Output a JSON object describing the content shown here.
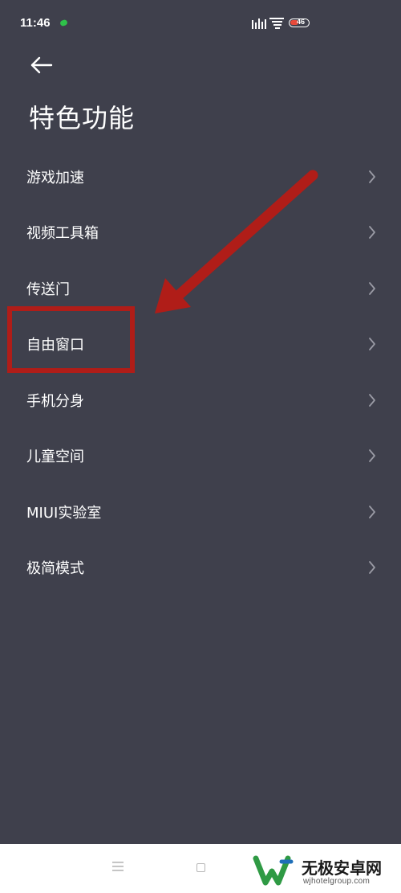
{
  "status_bar": {
    "time": "11:46",
    "battery_level": "46",
    "icons": [
      "wechat-icon",
      "signal-icon",
      "wifi-icon",
      "battery-icon"
    ]
  },
  "header": {
    "back_icon": "back-arrow-icon",
    "title": "特色功能"
  },
  "menu": {
    "items": [
      {
        "label": "游戏加速"
      },
      {
        "label": "视频工具箱"
      },
      {
        "label": "传送门"
      },
      {
        "label": "自由窗口"
      },
      {
        "label": "手机分身"
      },
      {
        "label": "儿童空间"
      },
      {
        "label": "MIUI实验室"
      },
      {
        "label": "极简模式"
      }
    ],
    "chevron_icon": "chevron-right-icon"
  },
  "annotation": {
    "highlighted_item": "自由窗口",
    "color": "#b01d18"
  },
  "nav_bar": {
    "icons": [
      "menu-icon",
      "home-icon"
    ]
  },
  "watermark": {
    "title": "无极安卓网",
    "url": "wjhotelgroup.com"
  },
  "colors": {
    "background": "#3f404c",
    "text": "#ffffff",
    "chevron": "#9a9ba5",
    "annotation": "#b01d18"
  }
}
